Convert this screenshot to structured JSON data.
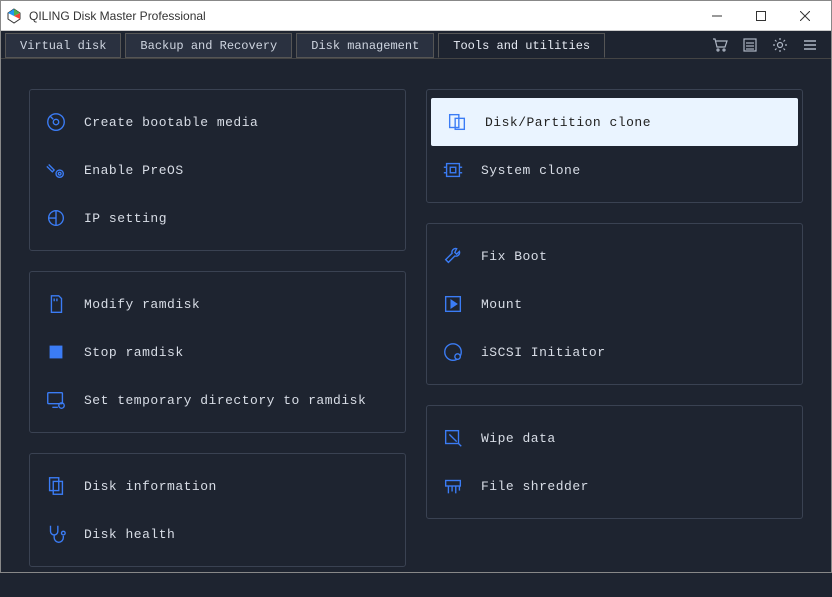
{
  "window": {
    "title": "QILING Disk Master Professional"
  },
  "tabs": {
    "virtual_disk": "Virtual disk",
    "backup_recovery": "Backup and Recovery",
    "disk_management": "Disk management",
    "tools_utilities": "Tools and utilities"
  },
  "left_panels": [
    {
      "items": [
        {
          "icon": "disc",
          "label": "Create bootable media"
        },
        {
          "icon": "gear-wrench",
          "label": "Enable PreOS"
        },
        {
          "icon": "network-arc",
          "label": "IP setting"
        }
      ]
    },
    {
      "items": [
        {
          "icon": "sd-card",
          "label": "Modify ramdisk"
        },
        {
          "icon": "stop-square",
          "label": "Stop ramdisk"
        },
        {
          "icon": "monitor-gear",
          "label": "Set temporary directory to ramdisk"
        }
      ]
    },
    {
      "items": [
        {
          "icon": "doc-copy",
          "label": "Disk information"
        },
        {
          "icon": "stethoscope",
          "label": "Disk health"
        }
      ]
    }
  ],
  "right_panels": [
    {
      "items": [
        {
          "icon": "rects-overlap",
          "label": "Disk/Partition clone",
          "selected": true
        },
        {
          "icon": "chip",
          "label": "System clone"
        }
      ]
    },
    {
      "items": [
        {
          "icon": "wrench-diag",
          "label": "Fix Boot"
        },
        {
          "icon": "play-box",
          "label": "Mount"
        },
        {
          "icon": "disc-ring",
          "label": "iSCSI Initiator"
        }
      ]
    },
    {
      "items": [
        {
          "icon": "eraser",
          "label": "Wipe data"
        },
        {
          "icon": "shredder",
          "label": "File shredder"
        }
      ]
    }
  ]
}
